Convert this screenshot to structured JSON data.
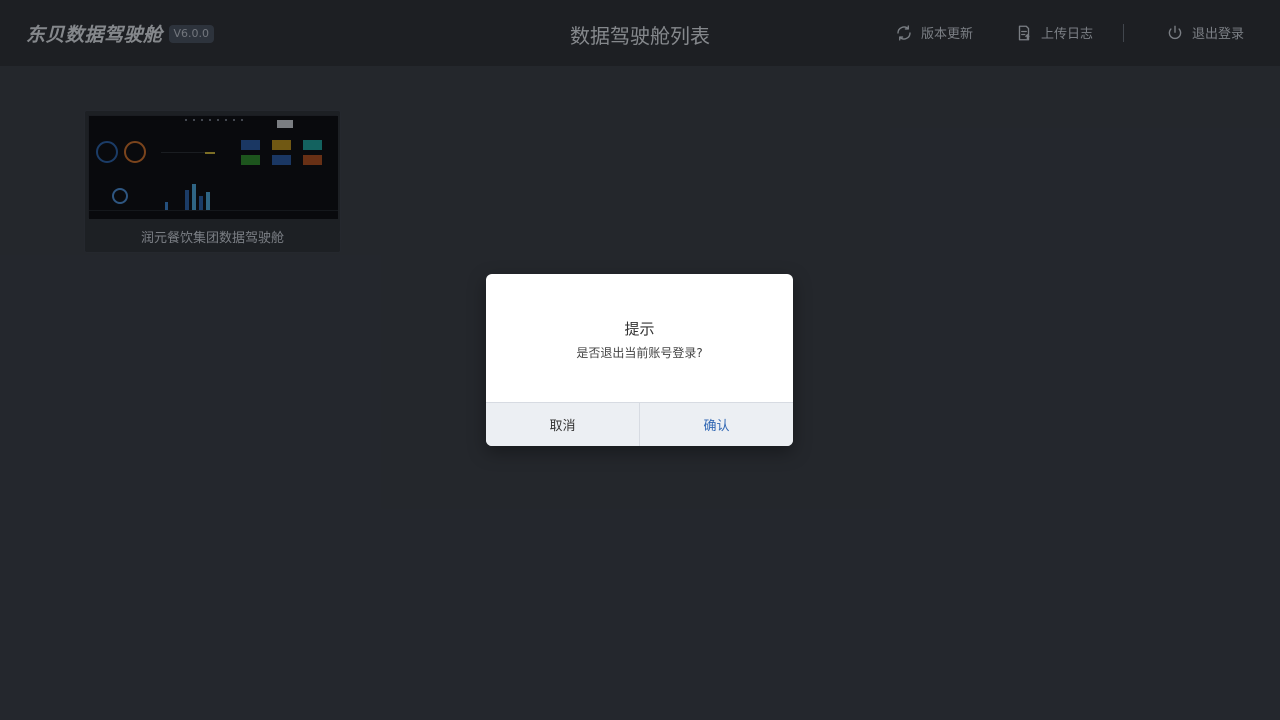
{
  "brand": {
    "name": "东贝数据驾驶舱",
    "version": "V6.0.0"
  },
  "header": {
    "title": "数据驾驶舱列表",
    "actions": [
      {
        "label": "版本更新",
        "icon": "refresh-icon"
      },
      {
        "label": "上传日志",
        "icon": "upload-log-icon"
      },
      {
        "label": "退出登录",
        "icon": "power-icon"
      }
    ]
  },
  "cockpits": [
    {
      "name": "润元餐饮集团数据驾驶舱"
    }
  ],
  "dialog": {
    "title": "提示",
    "message": "是否退出当前账号登录?",
    "cancel_label": "取消",
    "confirm_label": "确认"
  },
  "colors": {
    "background": "#22252a",
    "header_bg": "#2f3339",
    "primary_text": "#2f66b3"
  }
}
